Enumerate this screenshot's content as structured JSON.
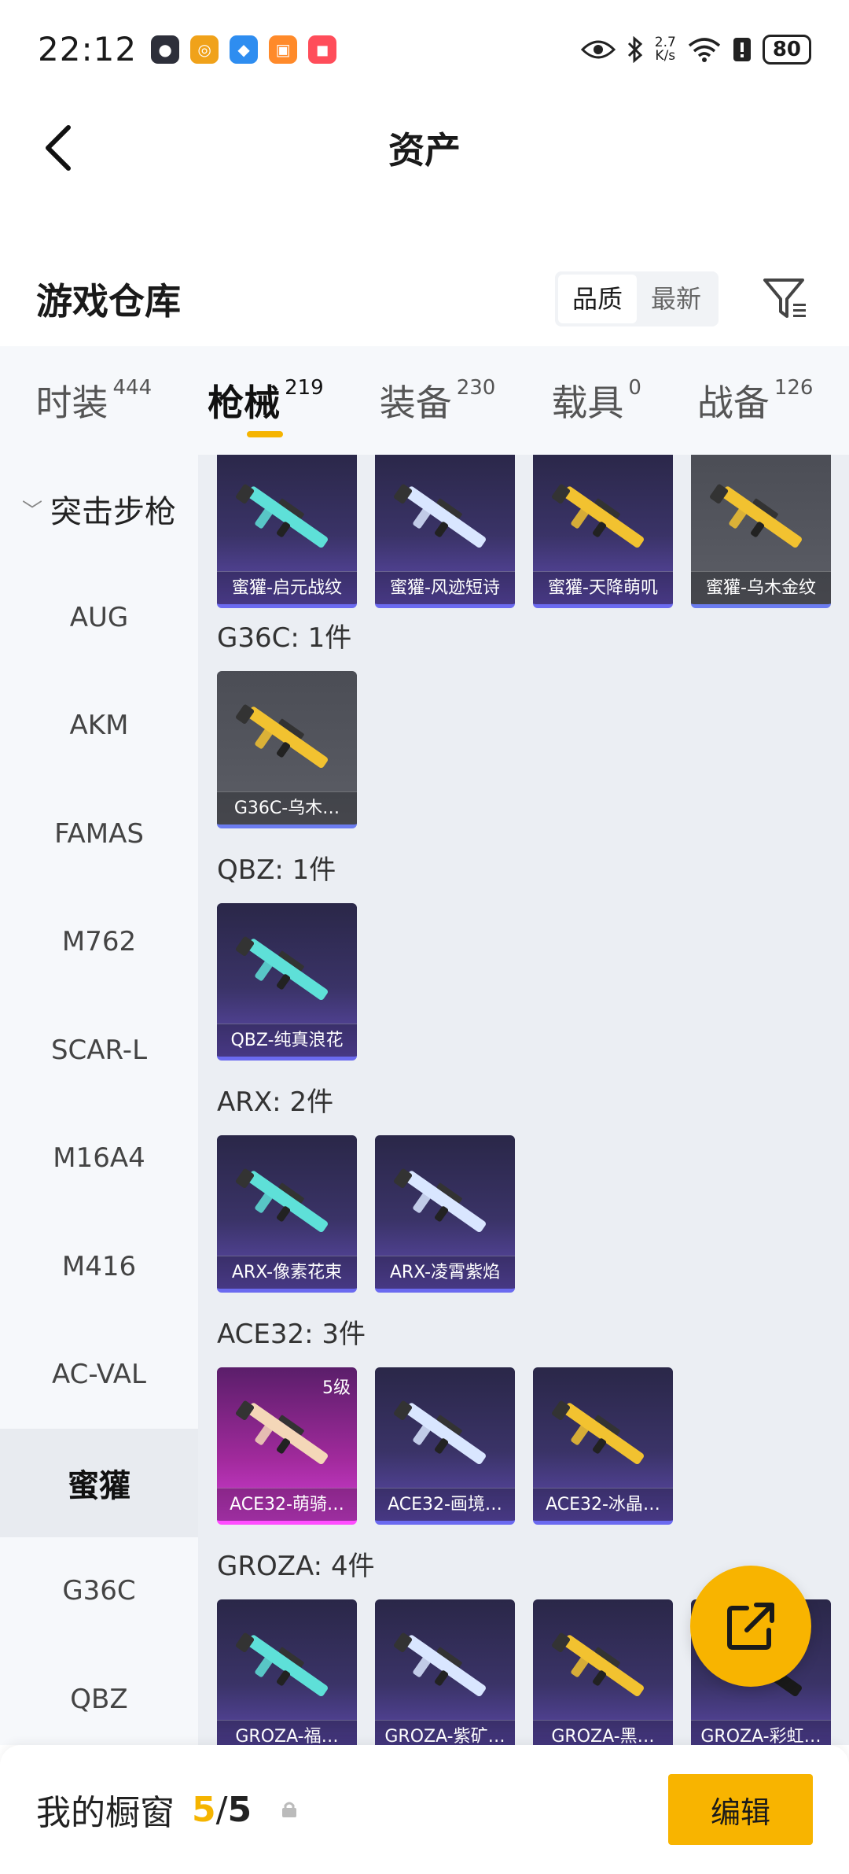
{
  "status": {
    "time": "22:12",
    "netspeed_value": "2.7",
    "netspeed_unit": "K/s",
    "battery": "80"
  },
  "header": {
    "title": "资产"
  },
  "warehouse": {
    "title": "游戏仓库",
    "sort_options": [
      "品质",
      "最新"
    ],
    "active_sort": "品质"
  },
  "tabs": [
    {
      "label": "时装",
      "count": "444"
    },
    {
      "label": "枪械",
      "count": "219",
      "active": true
    },
    {
      "label": "装备",
      "count": "230"
    },
    {
      "label": "载具",
      "count": "0"
    },
    {
      "label": "战备",
      "count": "126"
    }
  ],
  "sidebar": {
    "heading": "突击步枪",
    "items": [
      "AUG",
      "AKM",
      "FAMAS",
      "M762",
      "SCAR-L",
      "M16A4",
      "M416",
      "AC-VAL",
      "蜜獾",
      "G36C",
      "QBZ"
    ],
    "active": "蜜獾"
  },
  "groups": [
    {
      "title": "",
      "items": [
        {
          "name": "蜜獾-启元战纹",
          "style": "purple"
        },
        {
          "name": "蜜獾-风迹短诗",
          "style": "purple"
        },
        {
          "name": "蜜獾-天降萌叽",
          "style": "purple"
        },
        {
          "name": "蜜獾-乌木金纹",
          "style": "gray"
        }
      ]
    },
    {
      "title": "G36C: 1件",
      "items": [
        {
          "name": "G36C-乌木…",
          "style": "gray"
        }
      ]
    },
    {
      "title": "QBZ: 1件",
      "items": [
        {
          "name": "QBZ-纯真浪花",
          "style": "purple"
        }
      ]
    },
    {
      "title": "ARX: 2件",
      "items": [
        {
          "name": "ARX-像素花束",
          "style": "purple"
        },
        {
          "name": "ARX-凌霄紫焰",
          "style": "purple"
        }
      ]
    },
    {
      "title": "ACE32: 3件",
      "items": [
        {
          "name": "ACE32-萌骑…",
          "style": "pink",
          "level": "5级"
        },
        {
          "name": "ACE32-画境…",
          "style": "purple"
        },
        {
          "name": "ACE32-冰晶…",
          "style": "purple"
        }
      ]
    },
    {
      "title": "GROZA: 4件",
      "items": [
        {
          "name": "GROZA-福…",
          "style": "purple"
        },
        {
          "name": "GROZA-紫矿…",
          "style": "purple"
        },
        {
          "name": "GROZA-黑…",
          "style": "purple"
        },
        {
          "name": "GROZA-彩虹…",
          "style": "purple"
        }
      ]
    }
  ],
  "showcase": {
    "label": "我的橱窗",
    "current": "5",
    "slash": "/",
    "total": "5",
    "edit_label": "编辑"
  },
  "colors": {
    "accent": "#f8b400"
  },
  "icons": [
    "back-arrow-icon",
    "filter-icon",
    "share-out-icon",
    "lock-icon",
    "eye-icon",
    "bluetooth-icon",
    "wifi-icon"
  ]
}
